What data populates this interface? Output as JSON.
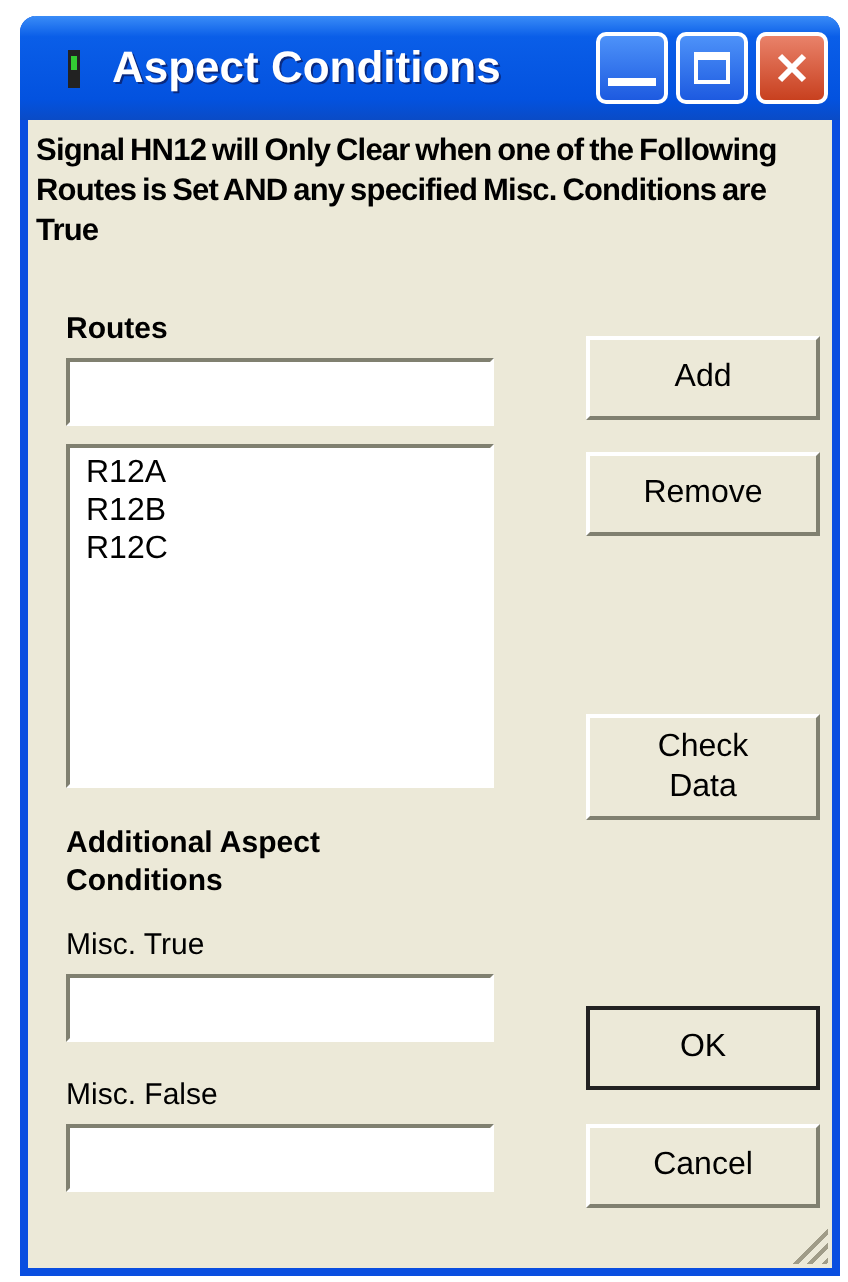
{
  "window": {
    "title": "Aspect Conditions"
  },
  "description": "Signal HN12 will Only Clear when one of the Following Routes is Set AND any specified Misc. Conditions are True",
  "routes": {
    "label": "Routes",
    "routes_list": [
      "R12A",
      "R12B",
      "R12C"
    ]
  },
  "additional": {
    "heading": "Additional Aspect Conditions",
    "fields": [
      {
        "label": "Misc. True"
      },
      {
        "label": "Misc. False"
      }
    ]
  },
  "buttons": [
    {
      "label": "Add",
      "kind": "normal"
    },
    {
      "label": "Remove",
      "kind": "normal"
    },
    {
      "label": "Check\nData",
      "kind": "normal"
    },
    {
      "label": "OK",
      "kind": "default"
    },
    {
      "label": "Cancel",
      "kind": "normal"
    }
  ]
}
